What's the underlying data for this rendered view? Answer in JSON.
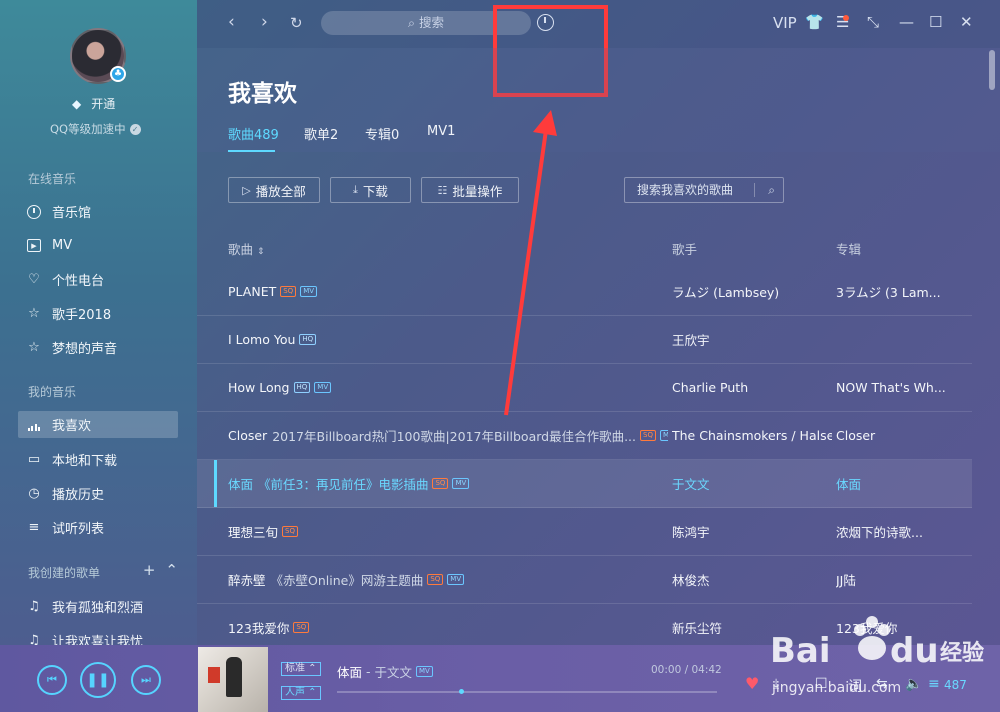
{
  "sidebar": {
    "vip_label": "开通",
    "qq_level": "QQ等级加速中",
    "online_title": "在线音乐",
    "online_items": [
      "音乐馆",
      "MV",
      "个性电台",
      "歌手2018",
      "梦想的声音"
    ],
    "my_title": "我的音乐",
    "my_items": [
      "我喜欢",
      "本地和下载",
      "播放历史",
      "试听列表"
    ],
    "created_title": "我创建的歌单",
    "created_items": [
      "我有孤独和烈酒",
      "让我欢喜让我忧"
    ]
  },
  "topbar": {
    "search_placeholder": "搜索",
    "vip": "VIP"
  },
  "page": {
    "title": "我喜欢",
    "tabs": [
      "歌曲489",
      "歌单2",
      "专辑0",
      "MV1"
    ],
    "buttons": {
      "play_all": "播放全部",
      "download": "下载",
      "batch": "批量操作"
    },
    "search_placeholder": "搜索我喜欢的歌曲"
  },
  "table": {
    "headers": {
      "song": "歌曲",
      "artist": "歌手",
      "album": "专辑"
    },
    "rows": [
      {
        "title": "PLANET",
        "sub": "",
        "tags": [
          "SQ",
          "MV"
        ],
        "artist": "ラムジ (Lambsey)",
        "album": "3ラムジ (3 Lam..."
      },
      {
        "title": "I Lomo You",
        "sub": "",
        "tags": [
          "HQ"
        ],
        "artist": "王欣宇",
        "album": ""
      },
      {
        "title": "How Long",
        "sub": "",
        "tags": [
          "HQ",
          "MV"
        ],
        "artist": "Charlie Puth",
        "album": "NOW That's Wh..."
      },
      {
        "title": "Closer",
        "sub": "2017年Billboard热门100歌曲|2017年Billboard最佳合作歌曲...",
        "tags": [
          "SQ",
          "MV"
        ],
        "artist": "The Chainsmokers / Halsey",
        "album": "Closer"
      },
      {
        "title": "体面",
        "sub": "《前任3：再见前任》电影插曲",
        "tags": [
          "SQ",
          "MV"
        ],
        "artist": "于文文",
        "album": "体面",
        "active": true
      },
      {
        "title": "理想三旬",
        "sub": "",
        "tags": [
          "SQ"
        ],
        "artist": "陈鸿宇",
        "album": "浓烟下的诗歌..."
      },
      {
        "title": "醉赤壁",
        "sub": "《赤壁Online》网游主题曲",
        "tags": [
          "SQ",
          "MV"
        ],
        "artist": "林俊杰",
        "album": "JJ陆"
      },
      {
        "title": "123我爱你",
        "sub": "",
        "tags": [
          "SQ"
        ],
        "artist": "新乐尘符",
        "album": "123我爱你"
      }
    ]
  },
  "player": {
    "quality": "标准",
    "effect": "人声",
    "song": "体面",
    "artist": "于文文",
    "time": "00:00 / 04:42",
    "playlist_count": "487",
    "progress": 0.32
  },
  "colors": {
    "accent": "#5ed9ff",
    "highlight": "#ff3b3b"
  }
}
